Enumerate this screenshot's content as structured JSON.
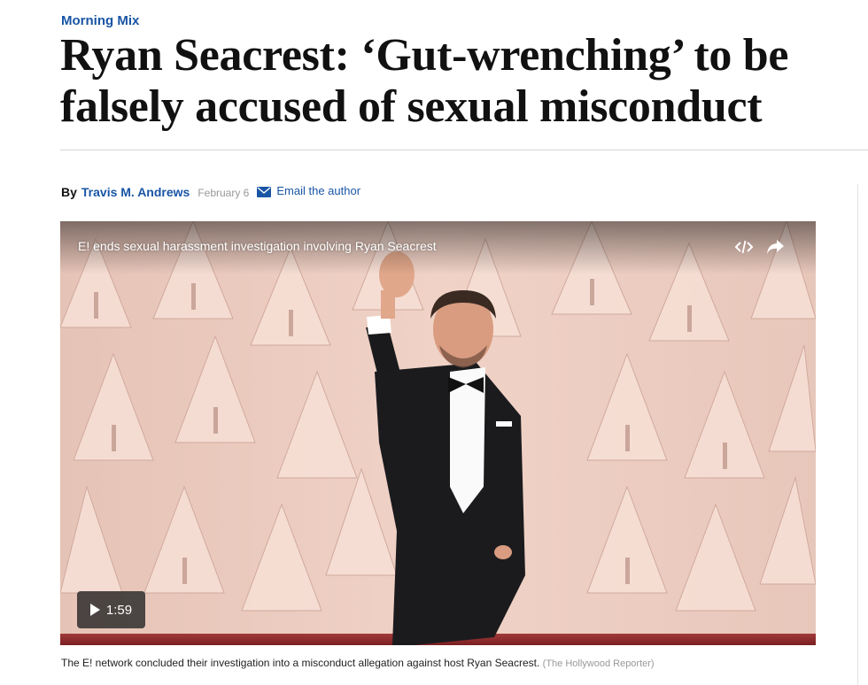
{
  "article": {
    "kicker": "Morning Mix",
    "headline": "Ryan Seacrest: ‘Gut-wrenching’ to be falsely accused of sexual misconduct",
    "byline": {
      "by": "By",
      "author": "Travis M. Andrews",
      "date": "February 6",
      "email_label": "Email the author"
    }
  },
  "video": {
    "title": "E! ends sexual harassment investigation involving Ryan Seacrest",
    "duration": "1:59",
    "icons": {
      "embed": "embed-code-icon",
      "share": "share-arrow-icon",
      "play": "play-icon"
    }
  },
  "caption": {
    "text": "The E! network concluded their investigation into a misconduct allegation against host Ryan Seacrest.",
    "credit": "(The Hollywood Reporter)"
  },
  "colors": {
    "accent": "#1955a5",
    "headline": "#111111",
    "muted": "#999999"
  }
}
